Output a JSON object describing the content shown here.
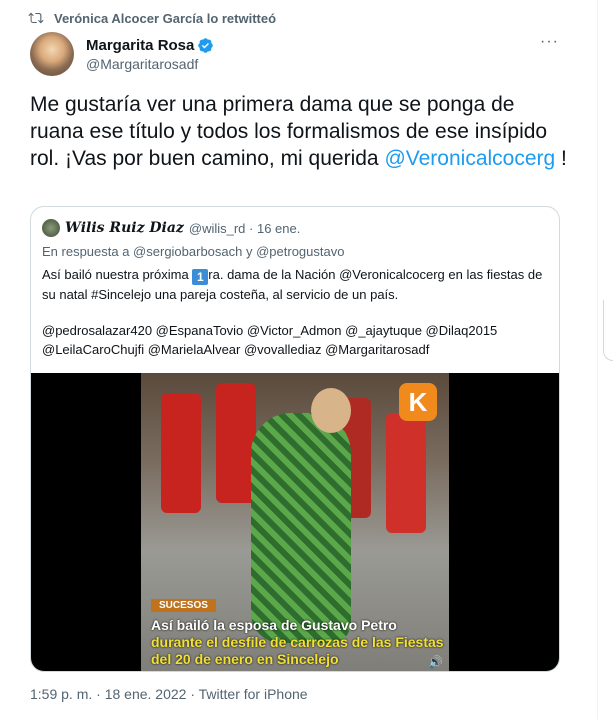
{
  "retweet": {
    "icon": "retweet-icon",
    "text": "Verónica Alcocer García lo retwitteó"
  },
  "author": {
    "name": "Margarita Rosa",
    "handle": "@Margaritarosadf",
    "verified": true
  },
  "more_label": "···",
  "tweet": {
    "text_before": "Me gustaría ver una primera dama que se ponga de ruana ese título y todos los formalismos de ese insípido rol. ¡Vas por buen camino, mi querida ",
    "mention": "@Veronicalcocerg",
    "text_after": " !"
  },
  "quote": {
    "name": "𝑾𝒊𝒍𝒊𝒔 𝑹𝒖𝒊𝒛 𝑫𝒊𝒂𝒛",
    "handle_date": "@wilis_rd · 16 ene.",
    "reply": "En respuesta a @sergiobarbosach y @petrogustavo",
    "text_before_badge": "Así bailó nuestra próxima ",
    "badge": "1",
    "text_after_badge": "ra. dama de la Nación @Veronicalcocerg en las fiestas de su natal #Sincelejo una pareja costeña, al servicio de un país.",
    "tags": "@pedrosalazar420 @EspanaTovio @Victor_Admon @_ajaytuque @Dilaq2015 @LeilaCaroChujfi @MarielaAlvear @vovallediaz @Margaritarosadf",
    "video": {
      "brand_badge": "SUCESOS",
      "caption_white": "Así bailó la esposa de Gustavo Petro",
      "caption_yellow": "durante el desfile de carrozas de las Fiestas del 20 de enero en Sincelejo",
      "speaker": "🔊"
    }
  },
  "meta": "1:59 p. m. · 18 ene. 2022 · Twitter for iPhone",
  "colors": {
    "link": "#1d9bf0",
    "secondary": "#536471",
    "text": "#0f1419"
  }
}
